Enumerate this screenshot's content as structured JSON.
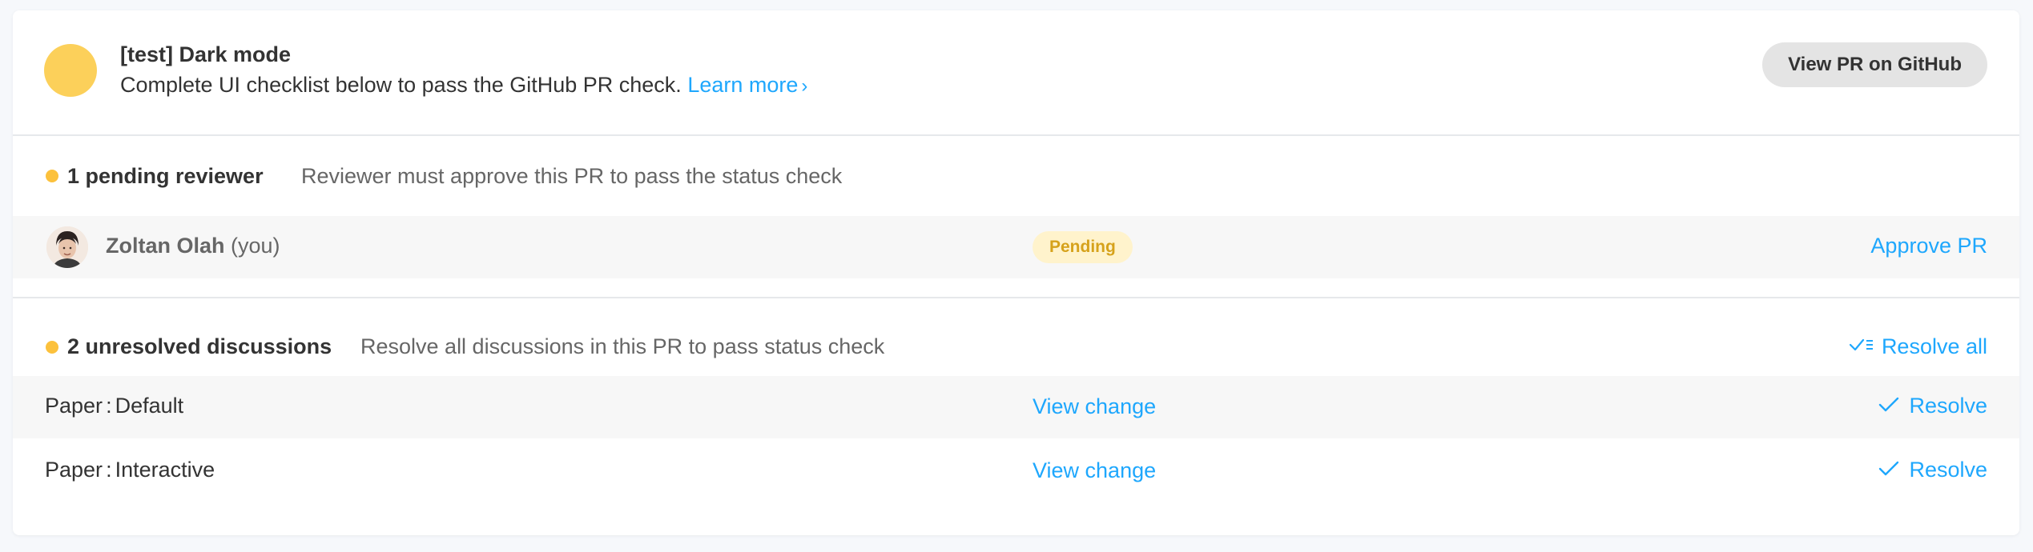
{
  "header": {
    "title": "[test] Dark mode",
    "subtitle": "Complete UI checklist below to pass the GitHub PR check.",
    "learn_more": "Learn more",
    "view_pr_button": "View PR on GitHub",
    "status_color": "#fcd05a"
  },
  "reviewers": {
    "title": "1 pending reviewer",
    "description": "Reviewer must approve this PR to pass the status check",
    "items": [
      {
        "name": "Zoltan Olah",
        "you_label": "(you)",
        "status": "Pending",
        "action": "Approve PR"
      }
    ]
  },
  "discussions": {
    "title": "2 unresolved discussions",
    "description": "Resolve all discussions in this PR to pass status check",
    "resolve_all": "Resolve all",
    "items": [
      {
        "component": "Paper",
        "story": "Default",
        "view_label": "View change",
        "resolve_label": "Resolve"
      },
      {
        "component": "Paper",
        "story": "Interactive",
        "view_label": "View change",
        "resolve_label": "Resolve"
      }
    ]
  },
  "colors": {
    "accent": "#1ea7fd",
    "pending_dot": "#fcc13c",
    "pending_badge_bg": "#fff3cc",
    "pending_badge_text": "#d6a21b"
  },
  "icons": {
    "learn_more": "chevron-right-icon",
    "resolve": "check-icon",
    "resolve_all": "check-list-icon",
    "reviewer_status": "pending-dot-icon"
  }
}
